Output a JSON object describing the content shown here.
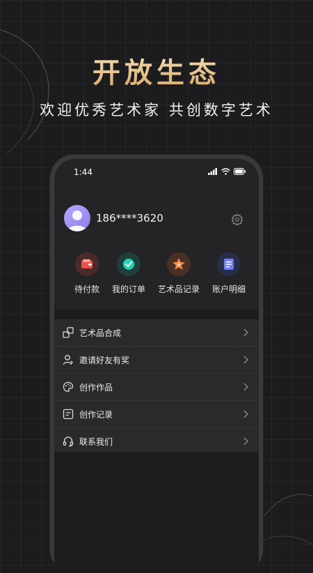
{
  "promo": {
    "headline": "开放生态",
    "subline": "欢迎优秀艺术家 共创数字艺术"
  },
  "status_bar": {
    "time": "1:44"
  },
  "profile": {
    "phone": "186****3620"
  },
  "quick_actions": [
    {
      "label": "待付款",
      "icon": "wallet-icon",
      "color": "#e8504a"
    },
    {
      "label": "我的订单",
      "icon": "check-circle-icon",
      "color": "#27d3b8"
    },
    {
      "label": "艺术品记录",
      "icon": "star-icon",
      "color": "#f58a4a"
    },
    {
      "label": "账户明细",
      "icon": "document-icon",
      "color": "#6f7cf2"
    }
  ],
  "menu": [
    {
      "label": "艺术品合成",
      "icon": "compose-icon"
    },
    {
      "label": "邀请好友有奖",
      "icon": "invite-user-icon"
    },
    {
      "label": "创作作品",
      "icon": "palette-icon"
    },
    {
      "label": "创作记录",
      "icon": "record-icon"
    },
    {
      "label": "联系我们",
      "icon": "headset-icon"
    }
  ],
  "colors": {
    "headline_gold": "#e2b673",
    "background": "#1c1c1e",
    "panel": "#2a2a2c"
  }
}
